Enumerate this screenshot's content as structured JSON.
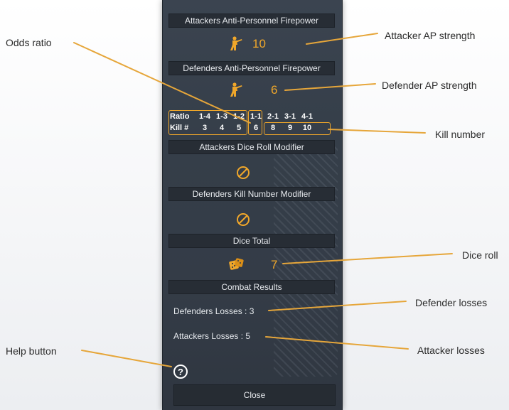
{
  "panel": {
    "attacker_ap_header": "Attackers Anti-Personnel Firepower",
    "attacker_ap_value": "10",
    "defender_ap_header": "Defenders Anti-Personnel Firepower",
    "defender_ap_value": "6",
    "table": {
      "row_labels": [
        "Ratio",
        "Kill #"
      ],
      "ratios": [
        "1-4",
        "1-3",
        "1-2",
        "1-1",
        "2-1",
        "3-1",
        "4-1"
      ],
      "kills": [
        "3",
        "4",
        "5",
        "6",
        "8",
        "9",
        "10"
      ]
    },
    "attacker_drm_header": "Attackers Dice Roll Modifier",
    "defender_knm_header": "Defenders Kill Number Modifier",
    "dice_total_header": "Dice Total",
    "dice_value": "7",
    "combat_results_header": "Combat Results",
    "defender_losses": "Defenders Losses : 3",
    "attacker_losses": "Attackers Losses : 5",
    "help_symbol": "?",
    "close_label": "Close"
  },
  "callouts": {
    "odds_ratio": "Odds ratio",
    "attacker_ap": "Attacker AP strength",
    "defender_ap": "Defender AP strength",
    "kill_number": "Kill number",
    "dice_roll": "Dice roll",
    "defender_losses": "Defender losses",
    "attacker_losses": "Attacker losses",
    "help_button": "Help button"
  },
  "colors": {
    "accent": "#f0a72a",
    "panel": "#353e49",
    "header": "#272d35"
  },
  "icons": [
    "soldier-icon",
    "no-modifier-icon",
    "dice-icon",
    "help-icon"
  ]
}
